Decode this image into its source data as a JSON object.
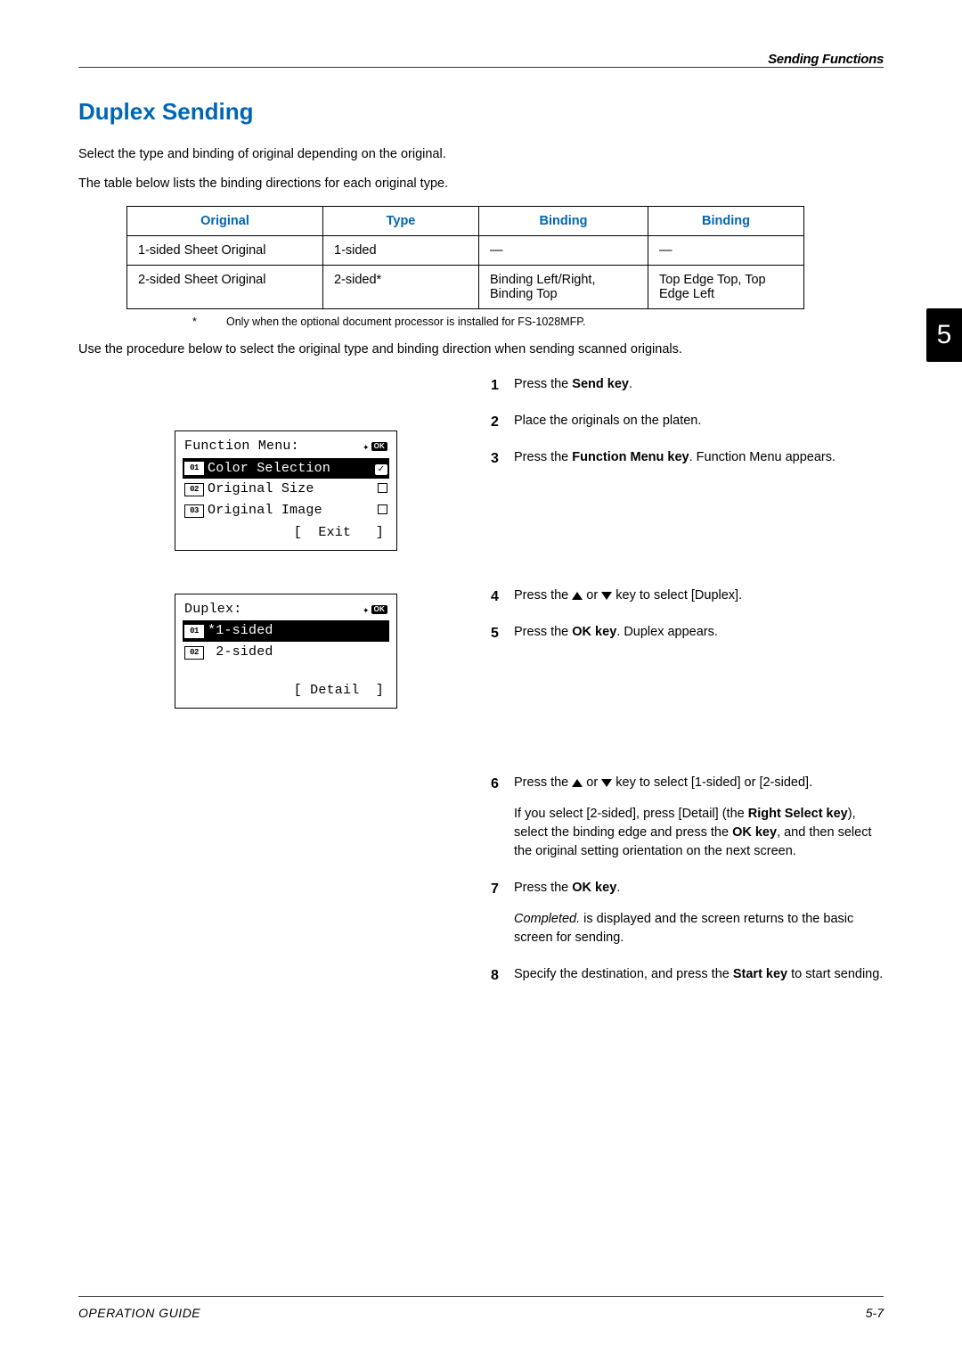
{
  "header": {
    "section": "Sending Functions"
  },
  "chapter_tab": "5",
  "title": "Duplex Sending",
  "intro1": "Select the type and binding of original depending on the original.",
  "intro2": "The table below lists the binding directions for each original type.",
  "table": {
    "headers": {
      "c1": "Original",
      "c2": "Type",
      "c3": "Binding",
      "c4": "Binding"
    },
    "rows": [
      {
        "c1": "1-sided Sheet Original",
        "c2": "1-sided",
        "c3": "—",
        "c4": "—"
      },
      {
        "c1": "2-sided Sheet Original",
        "c2": "2-sided*",
        "c3": "Binding Left/Right, Binding Top",
        "c4": "Top Edge Top, Top Edge Left"
      }
    ]
  },
  "footnote": {
    "star": "*",
    "text": "Only when the optional document processor is installed for FS-1028MFP."
  },
  "para_after_table": "Use the procedure below to select the original type and binding direction when sending scanned originals.",
  "lcd1": {
    "title": "Function Menu:",
    "ok": "OK",
    "items": [
      {
        "num": "01",
        "label": "Color Selection",
        "selected": true,
        "end": "check"
      },
      {
        "num": "02",
        "label": "Original Size",
        "selected": false,
        "end": "square"
      },
      {
        "num": "03",
        "label": "Original Image",
        "selected": false,
        "end": "square"
      }
    ],
    "footer": "[  Exit   ]"
  },
  "lcd2": {
    "title": "Duplex:",
    "ok": "OK",
    "items": [
      {
        "num": "01",
        "label": "*1-sided",
        "selected": true
      },
      {
        "num": "02",
        "label": " 2-sided",
        "selected": false
      }
    ],
    "footer": "[ Detail  ]"
  },
  "steps": {
    "s1_a": "Press the ",
    "s1_b": "Send key",
    "s1_c": ".",
    "s2": "Place the originals on the platen.",
    "s3_a": "Press the ",
    "s3_b": "Function Menu key",
    "s3_c": ". Function Menu appears.",
    "s4_a": "Press the ",
    "s4_b": " or ",
    "s4_c": " key to select [Duplex].",
    "s5_a": "Press the ",
    "s5_b": "OK key",
    "s5_c": ". Duplex appears.",
    "s6_a": "Press the ",
    "s6_b": " or ",
    "s6_c": " key to select [1-sided] or [2-sided].",
    "s6_sub_a": "If you select [2-sided], press [Detail] (the ",
    "s6_sub_b": "Right Select key",
    "s6_sub_c": "), select the binding edge and press the ",
    "s6_sub_d": "OK key",
    "s6_sub_e": ", and then select the original setting orientation on the next screen.",
    "s7_a": "Press the ",
    "s7_b": "OK key",
    "s7_c": ".",
    "s7_sub_a": "Completed.",
    "s7_sub_b": " is displayed and the screen returns to the basic screen for sending.",
    "s8_a": "Specify the destination, and press the ",
    "s8_b": "Start key",
    "s8_c": " to start sending."
  },
  "footer": {
    "left": "OPERATION GUIDE",
    "right": "5-7"
  }
}
